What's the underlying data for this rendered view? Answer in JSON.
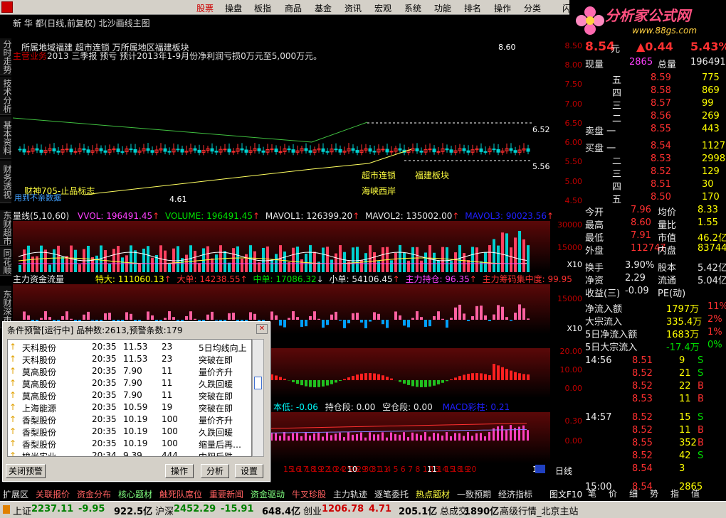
{
  "menu": [
    "股票",
    "操盘",
    "板指",
    "商品",
    "基金",
    "资讯",
    "宏观",
    "系统",
    "功能",
    "排名",
    "操作",
    "分类",
    "闪电"
  ],
  "active_menu": 0,
  "brand": {
    "name": "分析家公式网",
    "url": "www.88gs.com"
  },
  "chart_title": "新 华 都(日线,前复权) 北沙画线主图",
  "annotation1": "所属地域福建  超市连锁  万所属地区福建板块",
  "annotation2": {
    "key": "主营业务",
    "text": "2013 三季报 预亏 预计2013年1-9月份净利润亏损0万元至5,000万元。"
  },
  "side_tabs": [
    "分时走势",
    "技术分析",
    "基本资料",
    "财务透视",
    "东财超市",
    "同花顺",
    "东财深市"
  ],
  "price_axis": [
    "8.50",
    "8.00",
    "7.50",
    "7.00",
    "6.50",
    "6.00",
    "5.50",
    "5.00",
    "4.50"
  ],
  "price_labels": {
    "high": "8.60",
    "low": "4.61",
    "mark1": "6.52",
    "mark2": "5.56",
    "tag1": "超市连锁",
    "tag2": "福建板块",
    "tag3": "海峡西岸",
    "tag4": "财神705-止品标志",
    "tag5": "用到不亲数据"
  },
  "vol_header": {
    "lead": "量线(5,10,60)",
    "vvol": "VVOL: 196491.45",
    "volume": "VOLUME: 196491.45",
    "mavol1": "MAVOL1: 126399.20",
    "mavol2": "MAVOL2: 135002.00",
    "mavol3": "MAVOL3: 90023.56"
  },
  "vol_axis": [
    "30000",
    "15000",
    "X10"
  ],
  "fund_header": {
    "lead": "主力资金流量",
    "big": "特大: 111060.13",
    "large": "大单: 14238.55",
    "mid": "中单: 17086.32",
    "small": "小单: 54106.45",
    "hold": "主力持仓: 96.35",
    "conc": "主力筹码集中度: 99.95"
  },
  "fund_axis": [
    "15000",
    "X10"
  ],
  "macd_axis": [
    "20.00",
    "10.00",
    "0.00"
  ],
  "bottom_header": {
    "low": "本低: -0.06",
    "hold": "持仓段: 0.00",
    "empty": "空仓段: 0.00",
    "macd": "MACD彩柱: 0.21"
  },
  "bottom_axis": [
    "0.30",
    "0.00"
  ],
  "dates": [
    "15",
    "16",
    "17",
    "18",
    "19",
    "22",
    "10",
    "24",
    "25",
    "26",
    "29",
    "30",
    "31",
    "11",
    "4",
    "5",
    "6",
    "7",
    "8",
    "12",
    "13",
    "14",
    "15",
    "18",
    "19",
    "20",
    "21",
    "22",
    "25",
    "26",
    "27",
    "28",
    "29",
    "12",
    "32",
    "33"
  ],
  "period": "日线",
  "quote": {
    "price": "8.54",
    "unit": "元",
    "change": "▲0.44",
    "pct": "5.43%",
    "cur_vol_label": "现量",
    "cur_vol": "2865",
    "total_label": "总量",
    "total": "196491",
    "asks": [
      {
        "l": "五",
        "p": "8.59",
        "v": "775"
      },
      {
        "l": "四",
        "p": "8.58",
        "v": "869"
      },
      {
        "l": "三",
        "p": "8.57",
        "v": "99"
      },
      {
        "l": "二",
        "p": "8.56",
        "v": "269"
      },
      {
        "l": "卖盘 一",
        "p": "8.55",
        "v": "443"
      }
    ],
    "bids": [
      {
        "l": "买盘 一",
        "p": "8.54",
        "v": "1127"
      },
      {
        "l": "二",
        "p": "8.53",
        "v": "2998"
      },
      {
        "l": "三",
        "p": "8.52",
        "v": "129"
      },
      {
        "l": "四",
        "p": "8.51",
        "v": "30"
      },
      {
        "l": "五",
        "p": "8.50",
        "v": "170"
      }
    ],
    "stats": [
      {
        "a": "今开",
        "av": "7.96",
        "b": "均价",
        "bv": "8.33"
      },
      {
        "a": "最高",
        "av": "8.60",
        "b": "量比",
        "bv": "1.55"
      },
      {
        "a": "最低",
        "av": "7.91",
        "b": "市值",
        "bv": "46.2亿"
      },
      {
        "a": "外盘",
        "av": "112747",
        "b": "内盘",
        "bv": "83744"
      }
    ],
    "stats2": [
      {
        "a": "换手",
        "av": "3.90%",
        "b": "股本",
        "bv": "5.42亿"
      },
      {
        "a": "净资",
        "av": "2.29",
        "b": "流通",
        "bv": "5.04亿"
      },
      {
        "a": "收益(三)",
        "av": "-0.09",
        "b": "PE(动)",
        "bv": ""
      }
    ],
    "flows": [
      {
        "a": "净流入额",
        "v": "1797万",
        "p": "11%"
      },
      {
        "a": "大宗流入",
        "v": "335.4万",
        "p": "2%"
      },
      {
        "a": "5日净流入额",
        "v": "1683万",
        "p": "1%"
      },
      {
        "a": "5日大宗流入",
        "v": "-17.4万",
        "p": "0%"
      }
    ],
    "ticks": [
      {
        "t": "14:56",
        "p": "8.51",
        "v": "9",
        "d": "S"
      },
      {
        "t": "",
        "p": "8.52",
        "v": "21",
        "d": "S"
      },
      {
        "t": "",
        "p": "8.52",
        "v": "22",
        "d": "B"
      },
      {
        "t": "",
        "p": "8.53",
        "v": "11",
        "d": "B"
      },
      {
        "t": "14:57",
        "p": "8.52",
        "v": "15",
        "d": "S"
      },
      {
        "t": "",
        "p": "8.52",
        "v": "11",
        "d": "B"
      },
      {
        "t": "",
        "p": "8.55",
        "v": "352",
        "d": "B"
      },
      {
        "t": "",
        "p": "8.52",
        "v": "42",
        "d": "S"
      },
      {
        "t": "",
        "p": "8.54",
        "v": "3",
        "d": ""
      },
      {
        "t": "15:00",
        "p": "8.54",
        "v": "2865",
        "d": ""
      }
    ],
    "btabs": [
      "笔",
      "价",
      "细",
      "势",
      "指",
      "值"
    ]
  },
  "alert": {
    "title": "条件预警[运行中] 品种数:2613,预警条数:179",
    "rows": [
      {
        "n": "天科股份",
        "t": "20:35",
        "p": "11.53",
        "c": "23",
        "r": "5日均线向上"
      },
      {
        "n": "天科股份",
        "t": "20:35",
        "p": "11.53",
        "c": "23",
        "r": "突破在即"
      },
      {
        "n": "莫高股份",
        "t": "20:35",
        "p": "7.90",
        "c": "11",
        "r": "量价齐升"
      },
      {
        "n": "莫高股份",
        "t": "20:35",
        "p": "7.90",
        "c": "11",
        "r": "久跌回暖"
      },
      {
        "n": "莫高股份",
        "t": "20:35",
        "p": "7.90",
        "c": "11",
        "r": "突破在即"
      },
      {
        "n": "上海能源",
        "t": "20:35",
        "p": "10.59",
        "c": "19",
        "r": "突破在即"
      },
      {
        "n": "香梨股份",
        "t": "20:35",
        "p": "10.19",
        "c": "100",
        "r": "量价齐升"
      },
      {
        "n": "香梨股份",
        "t": "20:35",
        "p": "10.19",
        "c": "100",
        "r": "久跌回暖"
      },
      {
        "n": "香梨股份",
        "t": "20:35",
        "p": "10.19",
        "c": "100",
        "r": "缩量后再…"
      },
      {
        "n": "梭光实业",
        "t": "20:34",
        "p": "9.39",
        "c": "444",
        "r": "中阴后跌…"
      }
    ],
    "close_btn": "关闭预警",
    "b1": "操作",
    "b2": "分析",
    "b3": "设置"
  },
  "tabs": [
    "扩展区",
    "关联报价",
    "资金分布",
    "核心题材",
    "触死队席位",
    "重要新闻",
    "资金驱动",
    "牛叉珍股",
    "主力轨迹",
    "逐笔委托",
    "热点题材",
    "一致预期",
    "经济指标"
  ],
  "tabs_right": "图文F10",
  "status": [
    {
      "l": "上证",
      "v": "2237.11",
      "c": "-9.95",
      "a": "922.5亿"
    },
    {
      "l": "沪深",
      "v": "2452.29",
      "c": "-15.91",
      "a": "648.4亿"
    },
    {
      "l": "创业",
      "v": "1206.78",
      "c": "4.71",
      "a": "205.1亿"
    }
  ],
  "status_extra": {
    "label": "总成交",
    "value": "1890亿",
    "info": "高级行情_北京主站"
  }
}
